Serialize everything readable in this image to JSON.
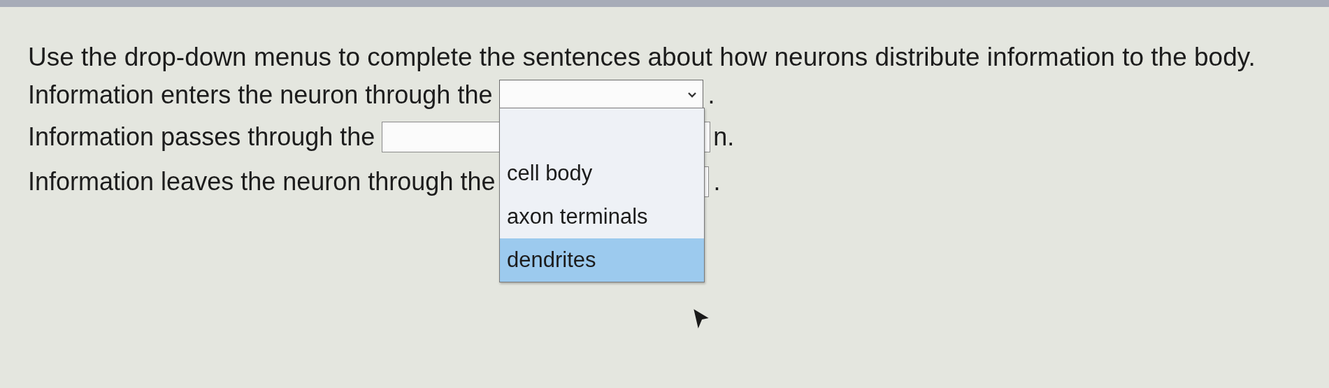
{
  "instruction": "Use the drop-down menus to complete the sentences about how neurons distribute information to the body.",
  "sentences": [
    {
      "prefix": "Information enters the neuron through the",
      "dropdown": {
        "expanded": true,
        "options": [
          {
            "label": "cell body",
            "selected": false
          },
          {
            "label": "axon terminals",
            "selected": false
          },
          {
            "label": "dendrites",
            "selected": true
          }
        ]
      },
      "suffix": "."
    },
    {
      "prefix": "Information passes through the",
      "dropdown": {
        "expanded": false
      },
      "suffix": "n."
    },
    {
      "prefix": "Information leaves the neuron through the",
      "dropdown": {
        "expanded": false
      },
      "suffix": "."
    }
  ]
}
